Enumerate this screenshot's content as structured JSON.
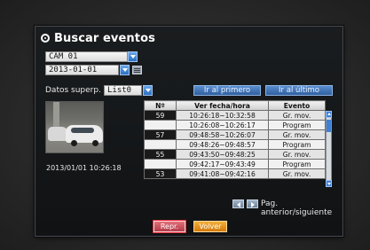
{
  "dialog": {
    "title": "Buscar eventos"
  },
  "camera": {
    "value": "CAM 01"
  },
  "date": {
    "value": "2013-01-01"
  },
  "overlay": {
    "label": "Datos superp.",
    "value": "List0"
  },
  "nav": {
    "first_label": "Ir al primero",
    "last_label": "Ir al último"
  },
  "thumbnail": {
    "timestamp": "2013/01/01 10:26:18"
  },
  "table": {
    "headers": [
      "Nº",
      "Ver fecha/hora",
      "Evento"
    ],
    "rows": [
      {
        "num": "59",
        "time": "10:26:18~10:32:58",
        "event": "Gr. mov."
      },
      {
        "num": "58",
        "time": "10:26:08~10:26:17",
        "event": "Program"
      },
      {
        "num": "57",
        "time": "09:48:58~10:26:07",
        "event": "Gr. mov."
      },
      {
        "num": "56",
        "time": "09:48:26~09:48:57",
        "event": "Program"
      },
      {
        "num": "55",
        "time": "09:43:50~09:48:25",
        "event": "Gr. mov."
      },
      {
        "num": "54",
        "time": "09:42:17~09:43:49",
        "event": "Program"
      },
      {
        "num": "53",
        "time": "09:41:08~09:42:16",
        "event": "Gr. mov."
      }
    ]
  },
  "paging": {
    "label": "Pag. anterior/siguiente"
  },
  "footer": {
    "play_label": "Repr.",
    "back_label": "Volver"
  },
  "colors": {
    "accent_blue": "#3e80d6",
    "play_red": "#b23c48",
    "back_orange": "#d27a0c"
  }
}
